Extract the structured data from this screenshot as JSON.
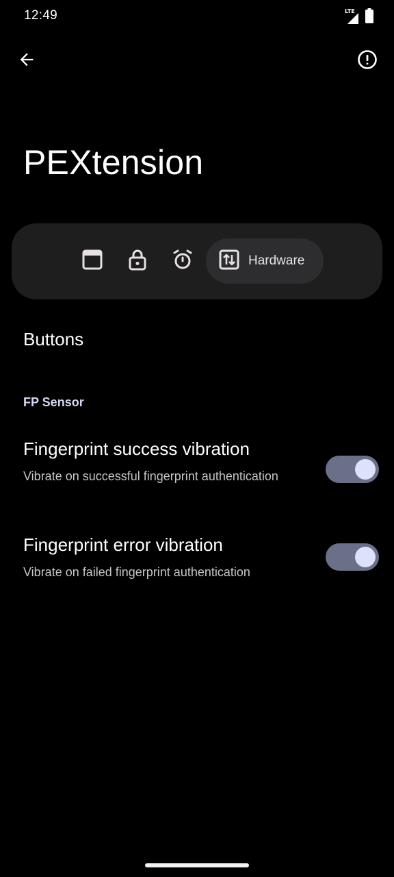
{
  "status_bar": {
    "time": "12:49",
    "network_label": "LTE",
    "icons": [
      "lte-signal-icon",
      "battery-icon"
    ]
  },
  "toolbar": {
    "back_icon": "arrow-back-icon",
    "info_icon": "info-alert-icon"
  },
  "app_title": "PEXtension",
  "nav": {
    "items": [
      {
        "icon": "window-icon",
        "label": ""
      },
      {
        "icon": "lock-icon",
        "label": ""
      },
      {
        "icon": "alarm-icon",
        "label": ""
      },
      {
        "icon": "hardware-swap-icon",
        "label": "Hardware",
        "selected": true
      }
    ]
  },
  "section": {
    "title": "Buttons"
  },
  "category": {
    "label": "FP Sensor"
  },
  "preferences": [
    {
      "title": "Fingerprint success vibration",
      "summary": "Vibrate on successful fingerprint authentication",
      "enabled": true
    },
    {
      "title": "Fingerprint error vibration",
      "summary": "Vibrate on failed fingerprint authentication",
      "enabled": true
    }
  ],
  "colors": {
    "background": "#000000",
    "nav_container": "#1e1e1e",
    "nav_selected": "#2d2d2f",
    "switch_track": "#6b7088",
    "switch_thumb": "#dee1fa",
    "category_text": "#d1d7ef"
  }
}
